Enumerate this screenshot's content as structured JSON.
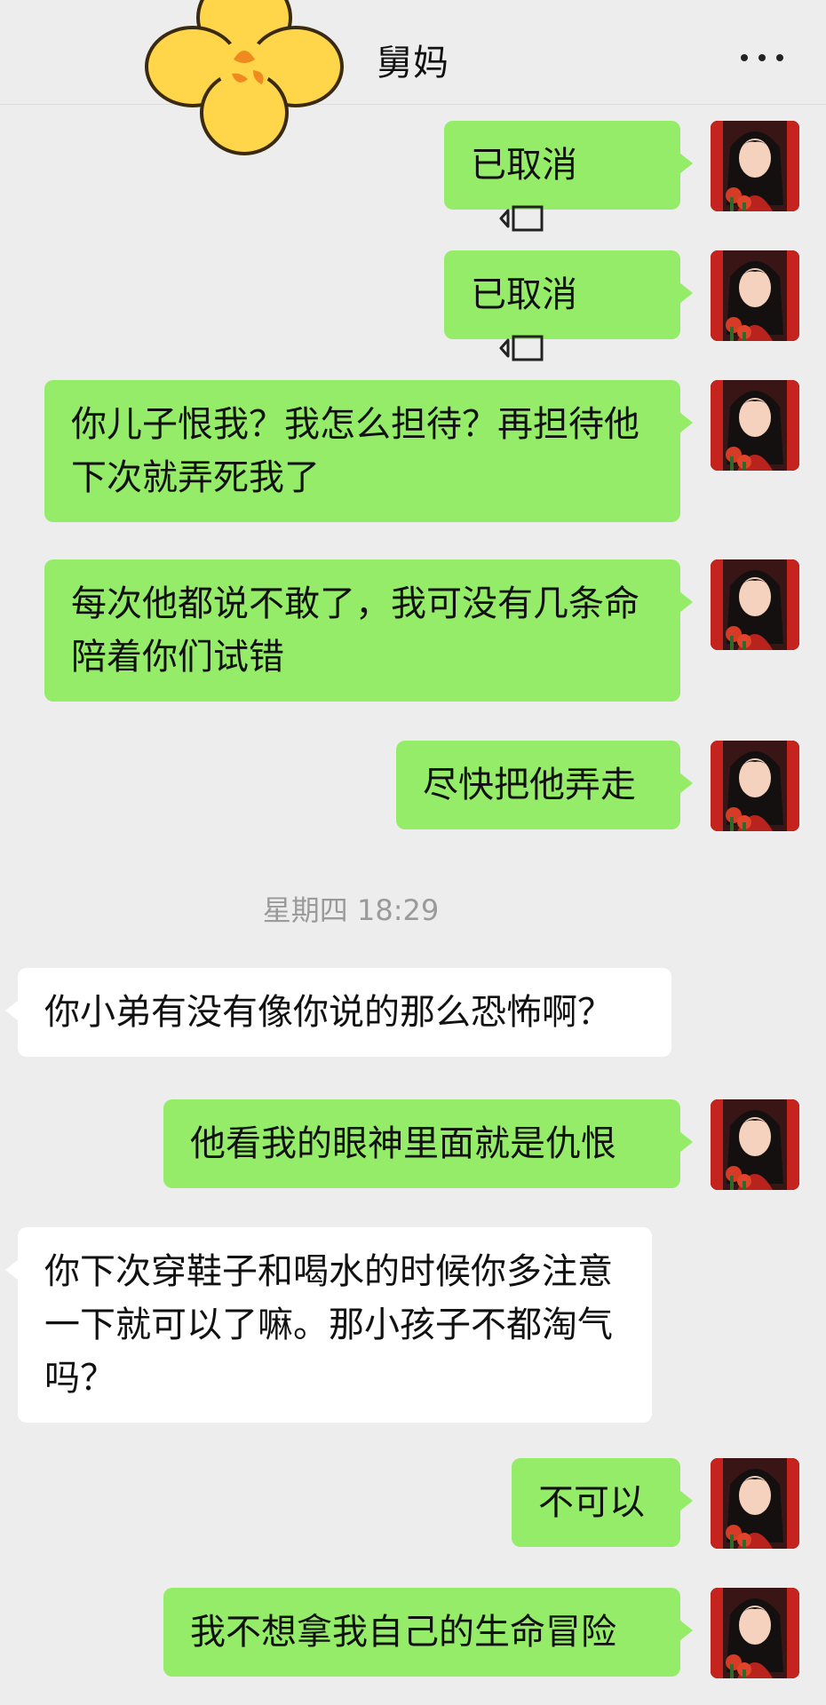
{
  "header": {
    "title": "舅妈",
    "more_icon": "more-dots-icon"
  },
  "colors": {
    "background": "#ededed",
    "self_bubble": "#95ec69",
    "other_bubble": "#ffffff",
    "timestamp": "#9a9a9a"
  },
  "messages": [
    {
      "sender": "self",
      "text": "已取消",
      "icon": "voice-call-icon"
    },
    {
      "sender": "self",
      "text": "已取消",
      "icon": "voice-call-icon"
    },
    {
      "sender": "self",
      "text": "你儿子恨我？我怎么担待？再担待他下次就弄死我了"
    },
    {
      "sender": "self",
      "text": "每次他都说不敢了，我可没有几条命陪着你们试错"
    },
    {
      "sender": "self",
      "text": "尽快把他弄走"
    },
    {
      "sender": "other",
      "text": "你小弟有没有像你说的那么恐怖啊？"
    },
    {
      "sender": "self",
      "text": "他看我的眼神里面就是仇恨"
    },
    {
      "sender": "other",
      "text": "你下次穿鞋子和喝水的时候你多注意一下就可以了嘛。那小孩子不都淘气吗？"
    },
    {
      "sender": "self",
      "text": "不可以"
    },
    {
      "sender": "self",
      "text": "我不想拿我自己的生命冒险"
    }
  ],
  "timestamp": "星期四 18:29"
}
